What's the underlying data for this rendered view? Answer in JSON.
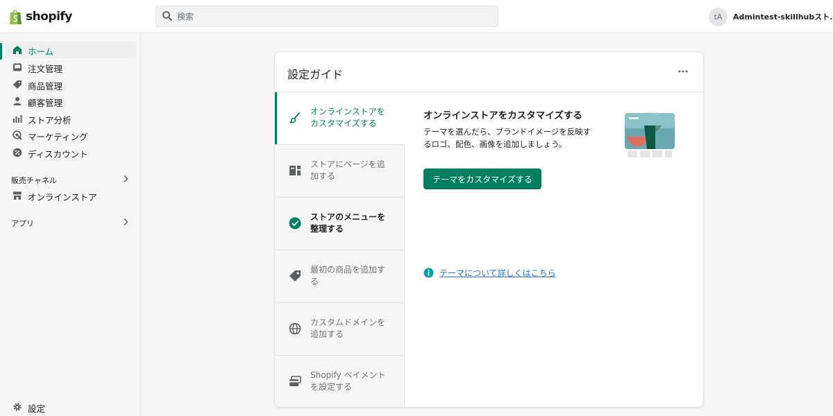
{
  "topbar": {
    "logo_text": "shopify",
    "search_placeholder": "検索",
    "avatar_initials": "tA",
    "account_name": "Admintest-skillhubスト..."
  },
  "sidebar": {
    "items": [
      {
        "label": "ホーム",
        "icon": "home-icon",
        "active": true
      },
      {
        "label": "注文管理",
        "icon": "inbox-icon"
      },
      {
        "label": "商品管理",
        "icon": "tag-icon"
      },
      {
        "label": "顧客管理",
        "icon": "person-icon"
      },
      {
        "label": "ストア分析",
        "icon": "bar-chart-icon"
      },
      {
        "label": "マーケティング",
        "icon": "target-icon"
      },
      {
        "label": "ディスカウント",
        "icon": "discount-icon"
      }
    ],
    "sales_channels_label": "販売チャネル",
    "online_store_label": "オンラインストア",
    "apps_label": "アプリ",
    "settings_label": "設定"
  },
  "setup_guide": {
    "title": "設定ガイド",
    "steps": [
      {
        "label": "オンラインストアを カスタマイズする",
        "icon": "paintbrush-icon",
        "state": "active"
      },
      {
        "label": "ストアにページを追 加する",
        "icon": "page-icon",
        "state": "todo"
      },
      {
        "label": "ストアのメニューを 整理する",
        "icon": "checkmark-circle-icon",
        "state": "done"
      },
      {
        "label": "最初の商品を追加す る",
        "icon": "tag-icon",
        "state": "todo"
      },
      {
        "label": "カスタムドメインを 追加する",
        "icon": "globe-icon",
        "state": "todo"
      },
      {
        "label": "Shopify ペイメント を設定する",
        "icon": "card-icon",
        "state": "todo"
      }
    ],
    "content": {
      "title": "オンラインストアをカスタマイズする",
      "description": "テーマを選んだら、ブランドイメージを反映するロゴ、配色、画像を追加しましょう。",
      "button_label": "テーマをカスタマイズする",
      "link_label": "テーマについて詳しくはこちら"
    }
  },
  "colors": {
    "accent": "#008060",
    "link": "#2c6ecb",
    "background": "#f6f6f7"
  }
}
